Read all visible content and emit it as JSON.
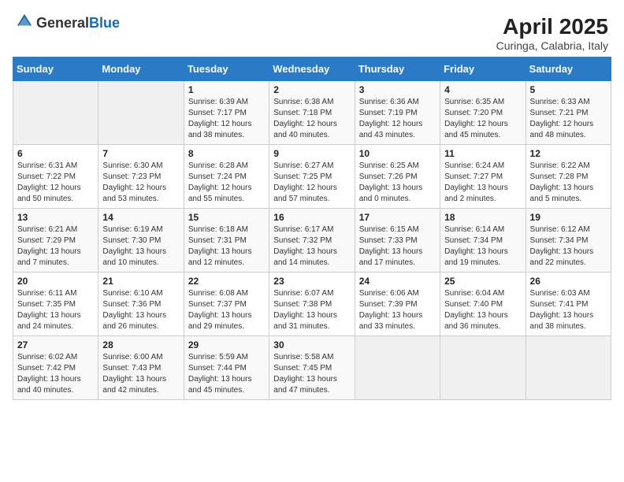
{
  "logo": {
    "general": "General",
    "blue": "Blue"
  },
  "title": "April 2025",
  "subtitle": "Curinga, Calabria, Italy",
  "headers": [
    "Sunday",
    "Monday",
    "Tuesday",
    "Wednesday",
    "Thursday",
    "Friday",
    "Saturday"
  ],
  "weeks": [
    [
      {
        "day": "",
        "sunrise": "",
        "sunset": "",
        "daylight": ""
      },
      {
        "day": "",
        "sunrise": "",
        "sunset": "",
        "daylight": ""
      },
      {
        "day": "1",
        "sunrise": "Sunrise: 6:39 AM",
        "sunset": "Sunset: 7:17 PM",
        "daylight": "Daylight: 12 hours and 38 minutes."
      },
      {
        "day": "2",
        "sunrise": "Sunrise: 6:38 AM",
        "sunset": "Sunset: 7:18 PM",
        "daylight": "Daylight: 12 hours and 40 minutes."
      },
      {
        "day": "3",
        "sunrise": "Sunrise: 6:36 AM",
        "sunset": "Sunset: 7:19 PM",
        "daylight": "Daylight: 12 hours and 43 minutes."
      },
      {
        "day": "4",
        "sunrise": "Sunrise: 6:35 AM",
        "sunset": "Sunset: 7:20 PM",
        "daylight": "Daylight: 12 hours and 45 minutes."
      },
      {
        "day": "5",
        "sunrise": "Sunrise: 6:33 AM",
        "sunset": "Sunset: 7:21 PM",
        "daylight": "Daylight: 12 hours and 48 minutes."
      }
    ],
    [
      {
        "day": "6",
        "sunrise": "Sunrise: 6:31 AM",
        "sunset": "Sunset: 7:22 PM",
        "daylight": "Daylight: 12 hours and 50 minutes."
      },
      {
        "day": "7",
        "sunrise": "Sunrise: 6:30 AM",
        "sunset": "Sunset: 7:23 PM",
        "daylight": "Daylight: 12 hours and 53 minutes."
      },
      {
        "day": "8",
        "sunrise": "Sunrise: 6:28 AM",
        "sunset": "Sunset: 7:24 PM",
        "daylight": "Daylight: 12 hours and 55 minutes."
      },
      {
        "day": "9",
        "sunrise": "Sunrise: 6:27 AM",
        "sunset": "Sunset: 7:25 PM",
        "daylight": "Daylight: 12 hours and 57 minutes."
      },
      {
        "day": "10",
        "sunrise": "Sunrise: 6:25 AM",
        "sunset": "Sunset: 7:26 PM",
        "daylight": "Daylight: 13 hours and 0 minutes."
      },
      {
        "day": "11",
        "sunrise": "Sunrise: 6:24 AM",
        "sunset": "Sunset: 7:27 PM",
        "daylight": "Daylight: 13 hours and 2 minutes."
      },
      {
        "day": "12",
        "sunrise": "Sunrise: 6:22 AM",
        "sunset": "Sunset: 7:28 PM",
        "daylight": "Daylight: 13 hours and 5 minutes."
      }
    ],
    [
      {
        "day": "13",
        "sunrise": "Sunrise: 6:21 AM",
        "sunset": "Sunset: 7:29 PM",
        "daylight": "Daylight: 13 hours and 7 minutes."
      },
      {
        "day": "14",
        "sunrise": "Sunrise: 6:19 AM",
        "sunset": "Sunset: 7:30 PM",
        "daylight": "Daylight: 13 hours and 10 minutes."
      },
      {
        "day": "15",
        "sunrise": "Sunrise: 6:18 AM",
        "sunset": "Sunset: 7:31 PM",
        "daylight": "Daylight: 13 hours and 12 minutes."
      },
      {
        "day": "16",
        "sunrise": "Sunrise: 6:17 AM",
        "sunset": "Sunset: 7:32 PM",
        "daylight": "Daylight: 13 hours and 14 minutes."
      },
      {
        "day": "17",
        "sunrise": "Sunrise: 6:15 AM",
        "sunset": "Sunset: 7:33 PM",
        "daylight": "Daylight: 13 hours and 17 minutes."
      },
      {
        "day": "18",
        "sunrise": "Sunrise: 6:14 AM",
        "sunset": "Sunset: 7:34 PM",
        "daylight": "Daylight: 13 hours and 19 minutes."
      },
      {
        "day": "19",
        "sunrise": "Sunrise: 6:12 AM",
        "sunset": "Sunset: 7:34 PM",
        "daylight": "Daylight: 13 hours and 22 minutes."
      }
    ],
    [
      {
        "day": "20",
        "sunrise": "Sunrise: 6:11 AM",
        "sunset": "Sunset: 7:35 PM",
        "daylight": "Daylight: 13 hours and 24 minutes."
      },
      {
        "day": "21",
        "sunrise": "Sunrise: 6:10 AM",
        "sunset": "Sunset: 7:36 PM",
        "daylight": "Daylight: 13 hours and 26 minutes."
      },
      {
        "day": "22",
        "sunrise": "Sunrise: 6:08 AM",
        "sunset": "Sunset: 7:37 PM",
        "daylight": "Daylight: 13 hours and 29 minutes."
      },
      {
        "day": "23",
        "sunrise": "Sunrise: 6:07 AM",
        "sunset": "Sunset: 7:38 PM",
        "daylight": "Daylight: 13 hours and 31 minutes."
      },
      {
        "day": "24",
        "sunrise": "Sunrise: 6:06 AM",
        "sunset": "Sunset: 7:39 PM",
        "daylight": "Daylight: 13 hours and 33 minutes."
      },
      {
        "day": "25",
        "sunrise": "Sunrise: 6:04 AM",
        "sunset": "Sunset: 7:40 PM",
        "daylight": "Daylight: 13 hours and 36 minutes."
      },
      {
        "day": "26",
        "sunrise": "Sunrise: 6:03 AM",
        "sunset": "Sunset: 7:41 PM",
        "daylight": "Daylight: 13 hours and 38 minutes."
      }
    ],
    [
      {
        "day": "27",
        "sunrise": "Sunrise: 6:02 AM",
        "sunset": "Sunset: 7:42 PM",
        "daylight": "Daylight: 13 hours and 40 minutes."
      },
      {
        "day": "28",
        "sunrise": "Sunrise: 6:00 AM",
        "sunset": "Sunset: 7:43 PM",
        "daylight": "Daylight: 13 hours and 42 minutes."
      },
      {
        "day": "29",
        "sunrise": "Sunrise: 5:59 AM",
        "sunset": "Sunset: 7:44 PM",
        "daylight": "Daylight: 13 hours and 45 minutes."
      },
      {
        "day": "30",
        "sunrise": "Sunrise: 5:58 AM",
        "sunset": "Sunset: 7:45 PM",
        "daylight": "Daylight: 13 hours and 47 minutes."
      },
      {
        "day": "",
        "sunrise": "",
        "sunset": "",
        "daylight": ""
      },
      {
        "day": "",
        "sunrise": "",
        "sunset": "",
        "daylight": ""
      },
      {
        "day": "",
        "sunrise": "",
        "sunset": "",
        "daylight": ""
      }
    ]
  ]
}
